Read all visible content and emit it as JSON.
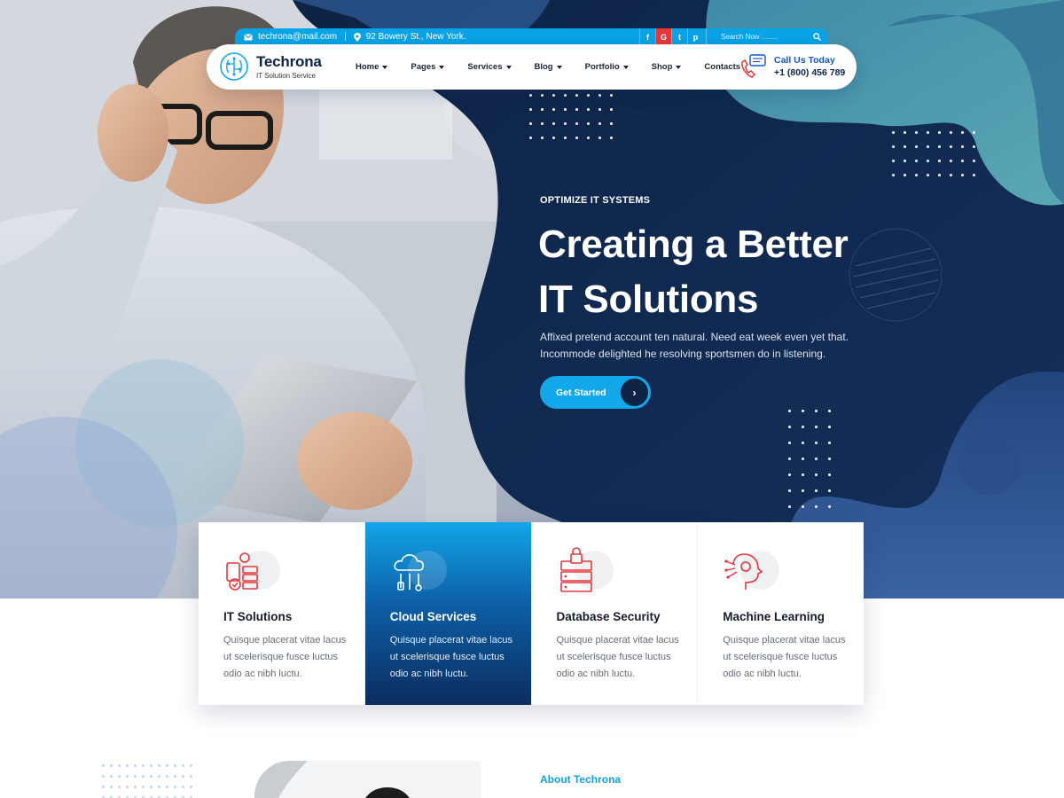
{
  "topbar": {
    "email": "techrona@mail.com",
    "address": "92 Bowery St., New York.",
    "socials": [
      "f",
      "G",
      "t",
      "p"
    ],
    "search_placeholder": "Search Now ........"
  },
  "brand": {
    "name": "Techrona",
    "tagline": "IT Solution Service"
  },
  "nav": {
    "items": [
      {
        "label": "Home",
        "has_dropdown": true
      },
      {
        "label": "Pages",
        "has_dropdown": true
      },
      {
        "label": "Services",
        "has_dropdown": true
      },
      {
        "label": "Blog",
        "has_dropdown": true
      },
      {
        "label": "Portfolio",
        "has_dropdown": true
      },
      {
        "label": "Shop",
        "has_dropdown": true
      },
      {
        "label": "Contacts",
        "has_dropdown": false
      }
    ],
    "call_label": "Call Us Today",
    "call_number": "+1 (800) 456 789"
  },
  "hero": {
    "eyebrow": "OPTIMIZE IT SYSTEMS",
    "headline_line1": "Creating a Better",
    "headline_line2": "IT Solutions",
    "subtext": "Affixed pretend account ten natural. Need eat week even yet that. Incommode delighted he resolving sportsmen do in listening.",
    "cta_label": "Get Started"
  },
  "services": [
    {
      "title": "IT Solutions",
      "desc": "Quisque placerat vitae lacus ut scelerisque fusce luctus odio ac nibh luctu.",
      "icon": "server-gear-icon",
      "active": false
    },
    {
      "title": "Cloud Services",
      "desc": "Quisque placerat vitae lacus ut scelerisque fusce luctus odio ac nibh luctu.",
      "icon": "cloud-tools-icon",
      "active": true
    },
    {
      "title": "Database Security",
      "desc": "Quisque placerat vitae lacus ut scelerisque fusce luctus odio ac nibh luctu.",
      "icon": "database-lock-icon",
      "active": false
    },
    {
      "title": "Machine Learning",
      "desc": "Quisque placerat vitae lacus ut scelerisque fusce luctus odio ac nibh luctu.",
      "icon": "ai-head-icon",
      "active": false
    }
  ],
  "about": {
    "label": "About Techrona"
  },
  "colors": {
    "primary": "#0aa3e6",
    "navy": "#0e2447",
    "icon_red": "#e8353b"
  }
}
